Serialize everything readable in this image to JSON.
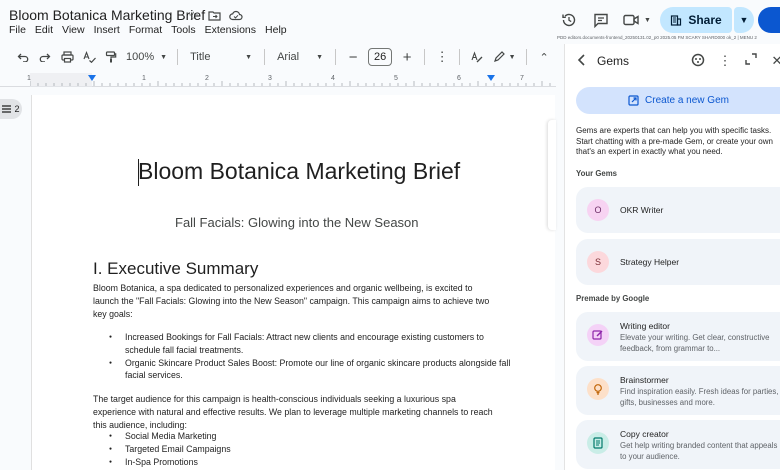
{
  "doc": {
    "title": "Bloom Botanica Marketing Brief",
    "menu": [
      "File",
      "Edit",
      "View",
      "Insert",
      "Format",
      "Tools",
      "Extensions",
      "Help"
    ],
    "meta": "PDD editors.documents-frontend_20250131.02_p0 2025.05 FM SCARY SHARD000 ok_2 | MENU 2"
  },
  "actions": {
    "share_label": "Share"
  },
  "toolbar": {
    "zoom": "100%",
    "style": "Title",
    "font": "Arial",
    "font_size": "26"
  },
  "ruler": {
    "numbers": [
      "1",
      "1",
      "2",
      "3",
      "4",
      "5",
      "6",
      "7"
    ]
  },
  "outline": {
    "count": "2"
  },
  "page": {
    "title": "Bloom Botanica Marketing Brief",
    "subtitle": "Fall Facials: Glowing into the New Season",
    "heading1": "I. Executive Summary",
    "para1": "Bloom Botanica, a spa dedicated to personalized experiences and organic wellbeing, is excited to launch the \"Fall Facials: Glowing into the New Season\" campaign. This campaign aims to achieve two key goals:",
    "goals": [
      "Increased Bookings for Fall Facials: Attract new clients and encourage existing customers to schedule fall facial treatments.",
      "Organic Skincare Product Sales Boost:  Promote our line of organic skincare products alongside fall facial services."
    ],
    "para2": "The target audience for this campaign is health-conscious individuals seeking a luxurious spa experience with natural and effective results. We plan to leverage multiple marketing channels to reach this audience, including:",
    "channels": [
      "Social Media Marketing",
      "Targeted Email Campaigns",
      "In-Spa Promotions"
    ]
  },
  "gems": {
    "title": "Gems",
    "create_label": "Create a new Gem",
    "intro": "Gems are experts that can help you with specific tasks. Start chatting with a pre-made Gem, or create your own that's an expert in exactly what you need.",
    "your_gems_label": "Your Gems",
    "your_gems": [
      {
        "initial": "O",
        "name": "OKR Writer",
        "color": "#f7d3f2",
        "fg": "#6e2f68"
      },
      {
        "initial": "S",
        "name": "Strategy Helper",
        "color": "#fcd8dc",
        "fg": "#7b2c34"
      }
    ],
    "premade_label": "Premade by Google",
    "premade": [
      {
        "name": "Writing editor",
        "desc": "Elevate your writing. Get clear, constructive feedback, from grammar to...",
        "color": "#f4d2f7",
        "icon": "edit-icon"
      },
      {
        "name": "Brainstormer",
        "desc": "Find inspiration easily. Fresh ideas for parties, gifts, businesses and more.",
        "color": "#fde0c9",
        "icon": "lightbulb-icon"
      },
      {
        "name": "Copy creator",
        "desc": "Get help writing branded content that appeals to your audience.",
        "color": "#c9ede7",
        "icon": "document-icon"
      }
    ]
  }
}
